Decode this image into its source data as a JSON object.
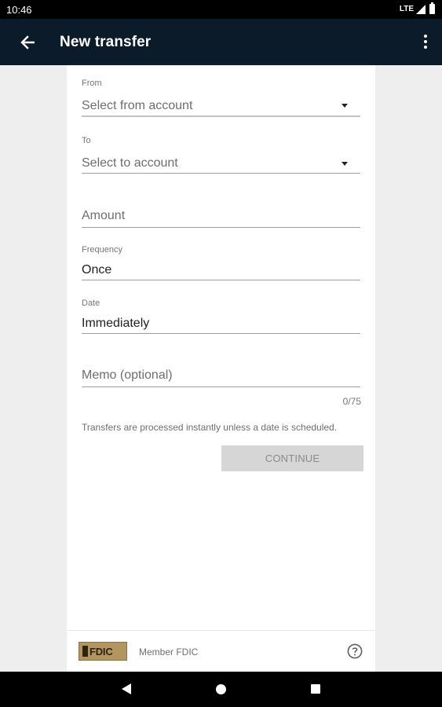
{
  "status_bar": {
    "time": "10:46",
    "network": "LTE"
  },
  "app_bar": {
    "title": "New transfer",
    "back_icon": "arrow-back-icon",
    "menu_icon": "more-vert-icon"
  },
  "form": {
    "from": {
      "label": "From",
      "placeholder": "Select from account"
    },
    "to": {
      "label": "To",
      "placeholder": "Select to account"
    },
    "amount": {
      "placeholder": "Amount"
    },
    "frequency": {
      "label": "Frequency",
      "value": "Once"
    },
    "date": {
      "label": "Date",
      "value": "Immediately"
    },
    "memo": {
      "placeholder": "Memo (optional)",
      "counter": "0/75"
    },
    "helper_text": "Transfers are processed instantly unless a date is scheduled.",
    "continue_label": "CONTINUE"
  },
  "footer": {
    "logo_text": "FDIC",
    "member_text": "Member FDIC",
    "help_icon": "help-circle-icon"
  },
  "colors": {
    "app_bar": "#0c1b2a",
    "fdic_gold": "#b3965f",
    "button_disabled": "#d6d6d6"
  }
}
